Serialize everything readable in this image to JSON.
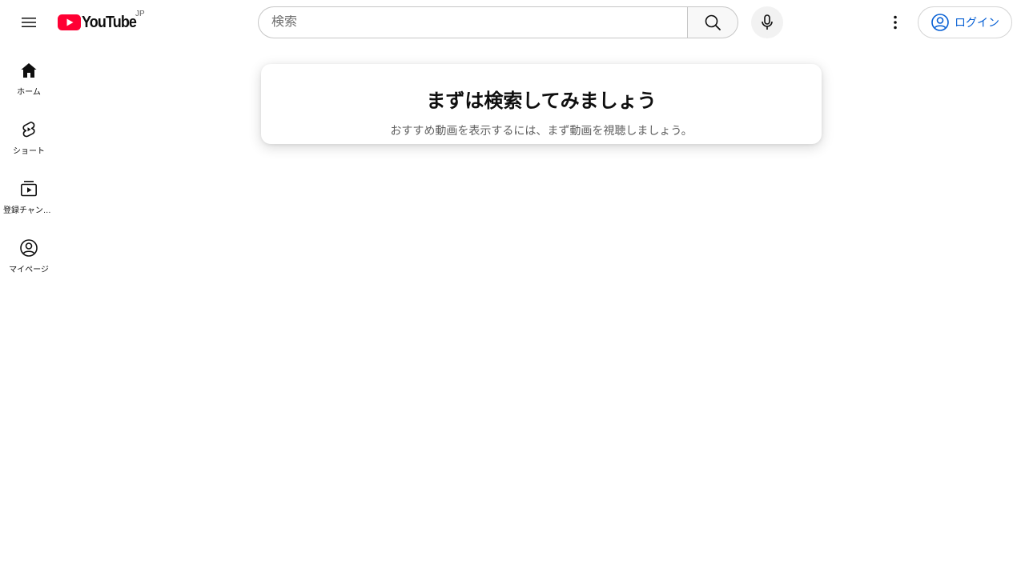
{
  "header": {
    "logo_text": "YouTube",
    "country_code": "JP",
    "search_placeholder": "検索",
    "search_value": "",
    "login_label": "ログイン",
    "brand_color": "#ff0033",
    "link_color": "#065fd4"
  },
  "icons": {
    "menu": "menu-icon",
    "search": "search-icon",
    "mic": "mic-icon",
    "more": "more-vert-icon",
    "account": "account-circle-icon"
  },
  "sidebar": {
    "items": [
      {
        "label": "ホーム",
        "icon": "home-icon"
      },
      {
        "label": "ショート",
        "icon": "shorts-icon"
      },
      {
        "label": "登録チャンネル",
        "icon": "subscriptions-icon"
      },
      {
        "label": "マイページ",
        "icon": "you-icon"
      }
    ]
  },
  "main": {
    "prompt_title": "まずは検索してみましょう",
    "prompt_subtitle": "おすすめ動画を表示するには、まず動画を視聴しましょう。"
  }
}
